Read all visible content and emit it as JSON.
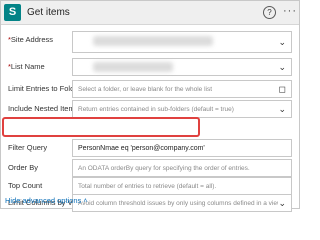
{
  "header": {
    "title": "Get items",
    "help_glyph": "?",
    "more_glyph": "···",
    "icon": "sharepoint-icon",
    "icon_letter": "S"
  },
  "fields": {
    "site_address": {
      "required": "*",
      "label": "Site Address",
      "value": ""
    },
    "list_name": {
      "required": "*",
      "label": "List Name",
      "value": ""
    },
    "limit_entries": {
      "label": "Limit Entries to Folder",
      "placeholder": "Select a folder, or leave blank for the whole list"
    },
    "include_nested": {
      "label": "Include Nested Items",
      "placeholder": "Return entries contained in sub-folders (default = true)"
    },
    "filter_query": {
      "label": "Filter Query",
      "value": "PersonNmae eq 'person@company.com'"
    },
    "order_by": {
      "label": "Order By",
      "placeholder": "An ODATA orderBy query for specifying the order of entries."
    },
    "top_count": {
      "label": "Top Count",
      "placeholder": "Total number of entries to retrieve (default = all)."
    },
    "limit_columns": {
      "label": "Limit Columns by View",
      "placeholder": "Avoid column threshold issues by only using columns defined in a view"
    }
  },
  "advanced": {
    "label": "Hide advanced options",
    "chevron": "˄"
  },
  "colors": {
    "accent": "#038387",
    "highlight": "#e0413f",
    "link": "#0b6fb8"
  }
}
